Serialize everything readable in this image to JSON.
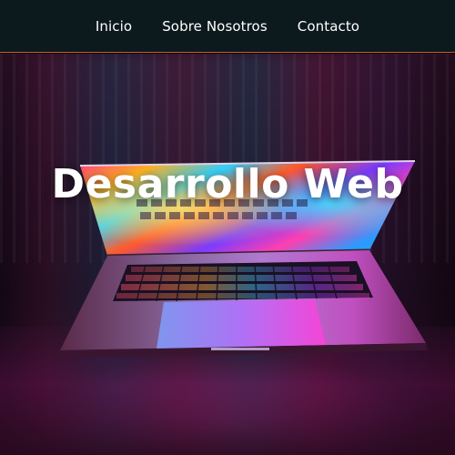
{
  "nav": {
    "items": [
      {
        "label": "Inicio"
      },
      {
        "label": "Sobre Nosotros"
      },
      {
        "label": "Contacto"
      }
    ]
  },
  "hero": {
    "title": "Desarrollo Web",
    "image_icon": "laptop-colorful-screen-illustration"
  },
  "colors": {
    "nav_background": "#0d1a1d",
    "nav_border": "#d8572a",
    "nav_text": "#ffffff",
    "hero_title": "#ffffff"
  }
}
